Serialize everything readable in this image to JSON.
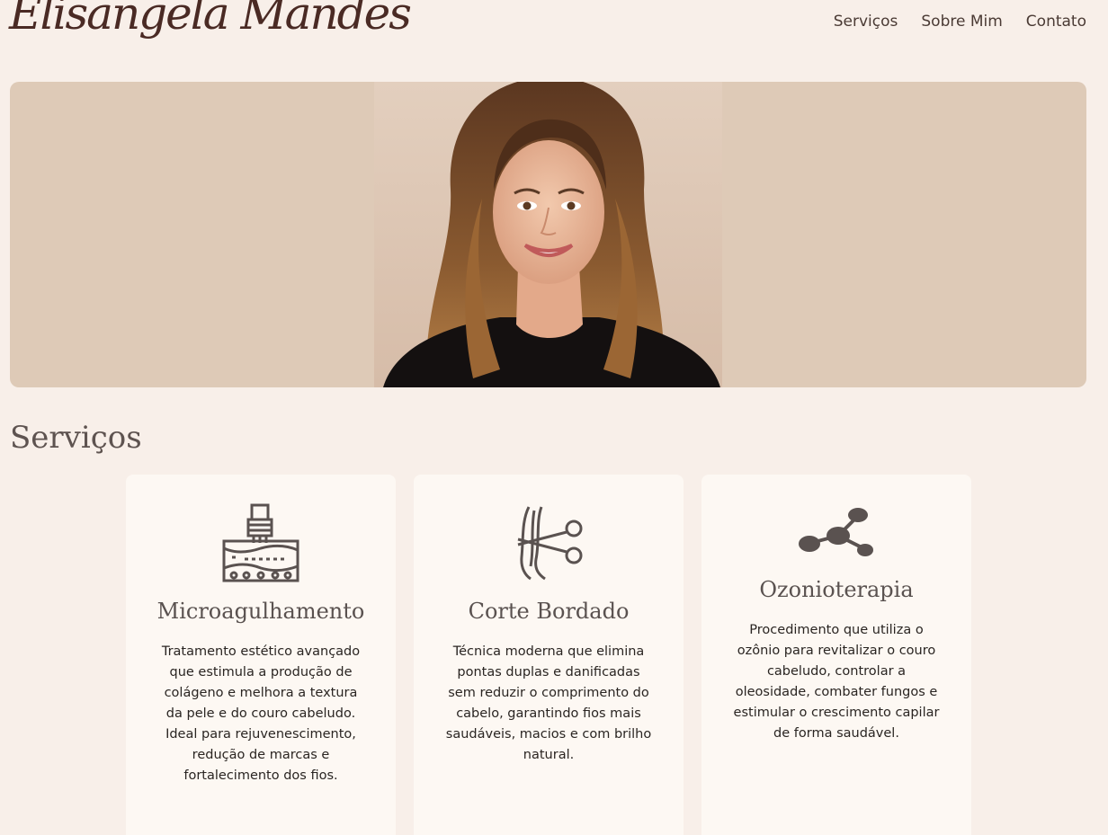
{
  "brand": {
    "logo_text": "Elisangela Mandes"
  },
  "nav": {
    "items": [
      {
        "label": "Serviços"
      },
      {
        "label": "Sobre Mim"
      },
      {
        "label": "Contato"
      }
    ]
  },
  "hero": {
    "image": "portrait-photo"
  },
  "services": {
    "title": "Serviços",
    "cards": [
      {
        "icon": "microneedling-icon",
        "title": "Microagulhamento",
        "description": "Tratamento estético avançado que estimula a produção de colágeno e melhora a textura da pele e do couro cabeludo. Ideal para rejuvenescimento, redução de marcas e fortalecimento dos fios."
      },
      {
        "icon": "hair-scissors-icon",
        "title": "Corte Bordado",
        "description": "Técnica moderna que elimina pontas duplas e danificadas sem reduzir o comprimento do cabelo, garantindo fios mais saudáveis, macios e com brilho natural."
      },
      {
        "icon": "molecule-icon",
        "title": "Ozonioterapia",
        "description": "Procedimento que utiliza o ozônio para revitalizar o couro cabeludo, controlar a oleosidade, combater fungos e estimular o crescimento capilar de forma saudável."
      }
    ]
  },
  "colors": {
    "background": "#f8efe9",
    "hero_bg": "#decab7",
    "card_bg": "#fdf8f3",
    "logo": "#4a2a24",
    "heading": "#5e5350"
  }
}
